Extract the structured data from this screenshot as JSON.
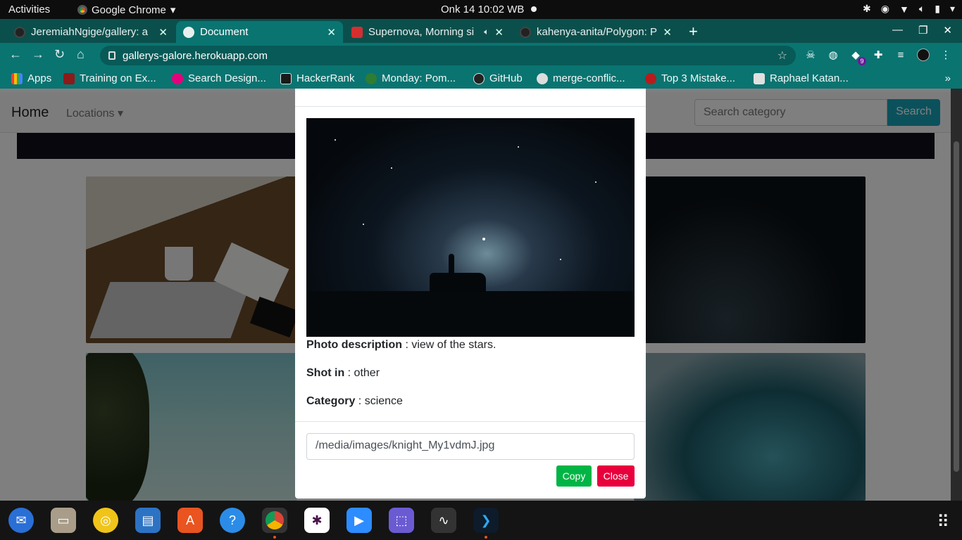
{
  "system": {
    "activities": "Activities",
    "app_name": "Google Chrome",
    "clock": "Onk 14  10:02 WB"
  },
  "tabs": [
    {
      "title": "JeremiahNgige/gallery: a",
      "active": false
    },
    {
      "title": "Document",
      "active": true
    },
    {
      "title": "Supernova, Morning si",
      "active": false
    },
    {
      "title": "kahenya-anita/Polygon: P",
      "active": false
    }
  ],
  "address": {
    "url": "gallerys-galore.herokuapp.com"
  },
  "extensions": {
    "badge": "9"
  },
  "bookmarks": [
    {
      "label": "Apps",
      "color": "#e8453c"
    },
    {
      "label": "Training on Ex...",
      "color": "#8b1a1a"
    },
    {
      "label": "Search Design...",
      "color": "#e4007c"
    },
    {
      "label": "HackerRank",
      "color": "#1a1a1a"
    },
    {
      "label": "Monday: Pom...",
      "color": "#2e7d32"
    },
    {
      "label": "GitHub",
      "color": "#222222"
    },
    {
      "label": "merge-conflic...",
      "color": "#dddddd"
    },
    {
      "label": "Top 3 Mistake...",
      "color": "#b71c1c"
    },
    {
      "label": "Raphael Katan...",
      "color": "#e0e0e0"
    }
  ],
  "page": {
    "brand": "Home",
    "locations_label": "Locations",
    "search_placeholder": "Search category",
    "search_button": "Search"
  },
  "modal": {
    "description_label": "Photo description",
    "description_value": " : view of the stars.",
    "shot_label": "Shot in",
    "shot_value": " : other",
    "category_label": "Category",
    "category_value": " : science",
    "image_path": "/media/images/knight_My1vdmJ.jpg",
    "copy_label": "Copy",
    "close_label": "Close"
  },
  "colors": {
    "chrome_frame": "#0a7471",
    "search_button": "#17a2b8",
    "copy_button": "#00b545",
    "close_button": "#e8003c"
  }
}
